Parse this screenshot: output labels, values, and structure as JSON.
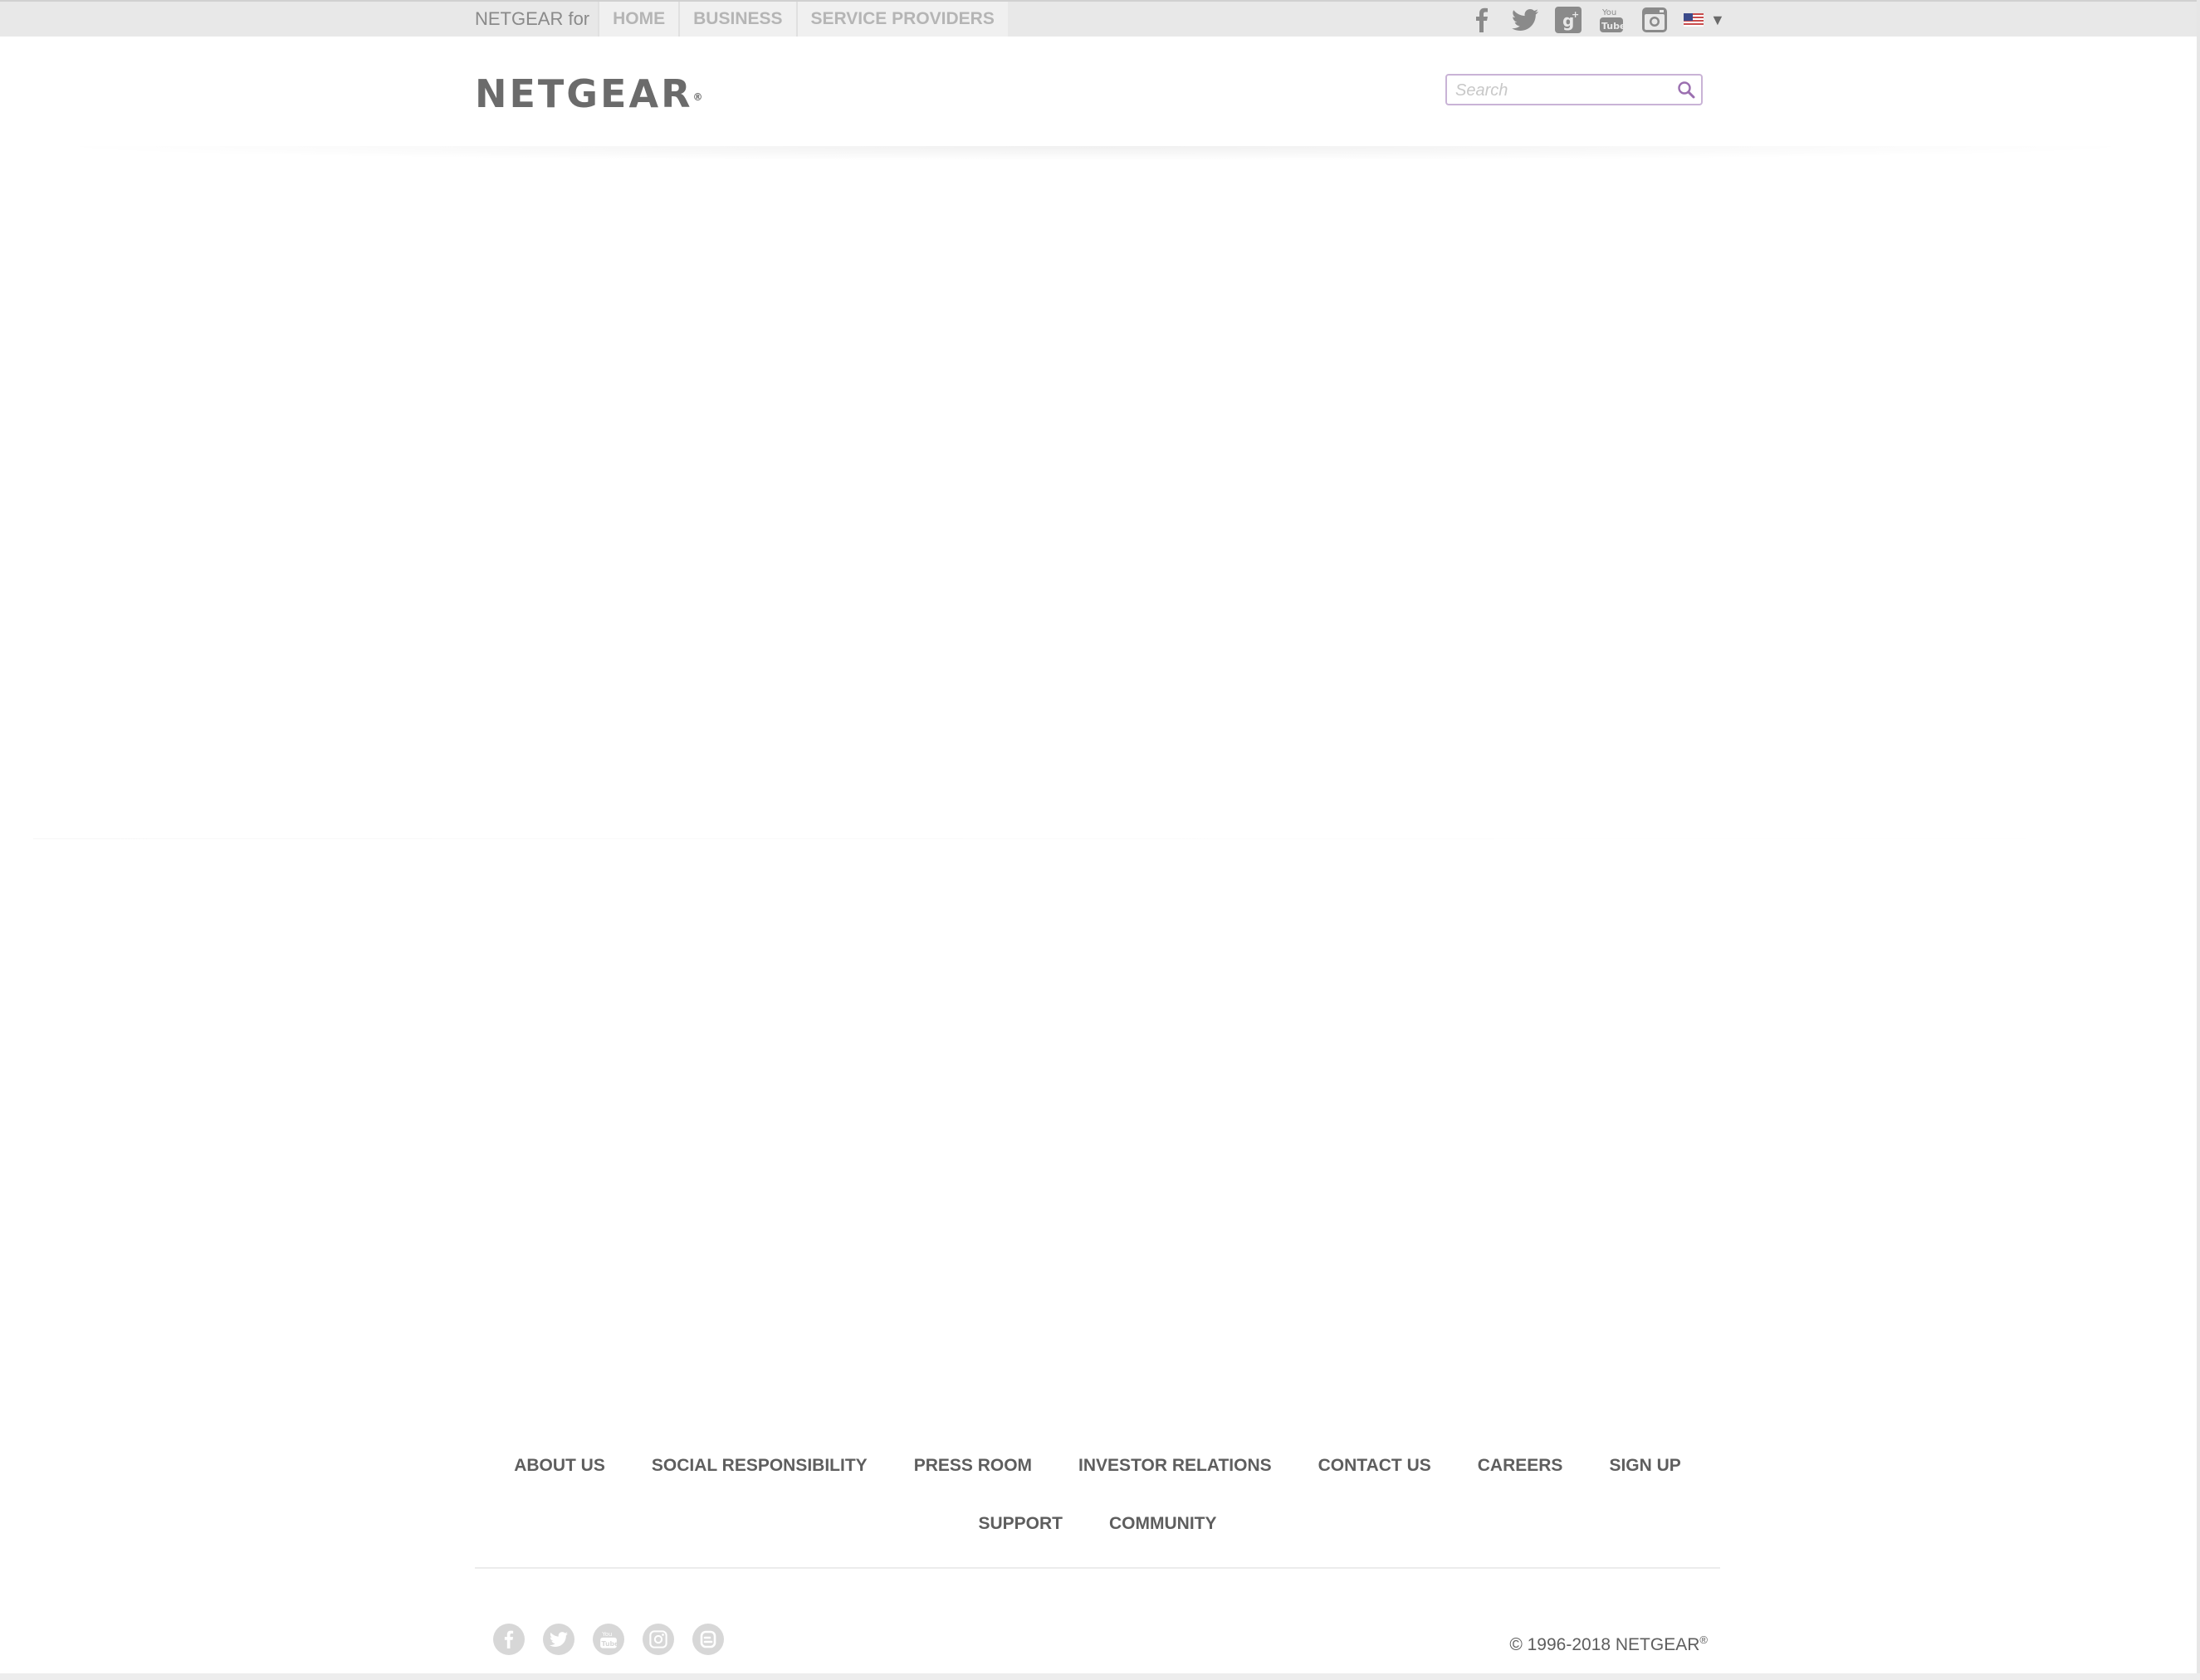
{
  "topbar": {
    "label": "NETGEAR for",
    "segments": [
      "HOME",
      "BUSINESS",
      "SERVICE PROVIDERS"
    ],
    "social_icons": [
      "facebook-icon",
      "twitter-icon",
      "google-plus-icon",
      "youtube-icon",
      "instagram-icon"
    ],
    "locale_caret": "▼"
  },
  "header": {
    "logo_text": "NETGEAR",
    "logo_mark": "®",
    "search_placeholder": "Search"
  },
  "footer": {
    "links_row1": [
      "ABOUT US",
      "SOCIAL RESPONSIBILITY",
      "PRESS ROOM",
      "INVESTOR RELATIONS",
      "CONTACT US",
      "CAREERS",
      "SIGN UP"
    ],
    "links_row2": [
      "SUPPORT",
      "COMMUNITY"
    ],
    "social_icons": [
      "facebook-icon",
      "twitter-icon",
      "youtube-icon",
      "instagram-icon",
      "blog-icon"
    ],
    "copyright": "© 1996-2018 NETGEAR",
    "copyright_mark": "®"
  },
  "colors": {
    "text_gray": "#5e5e5e",
    "topbar_bg": "#e8e8e8",
    "search_border": "#c9b3d6",
    "search_icon": "#9b6fb0"
  }
}
